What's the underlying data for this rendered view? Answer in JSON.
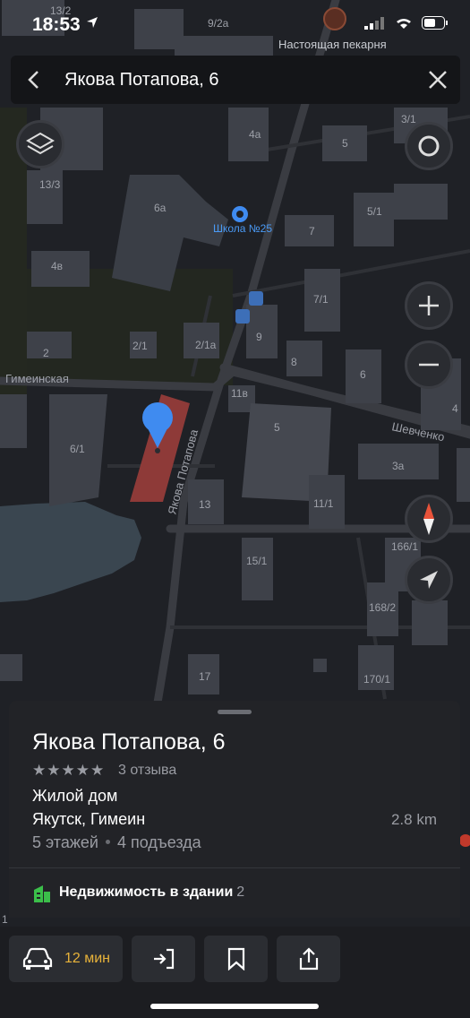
{
  "status_bar": {
    "time": "18:53"
  },
  "map": {
    "poi": {
      "bakery_name": "Настоящая пекарня",
      "school_name": "Школа №25"
    },
    "street_labels": [
      "Гимеинская",
      "Якова Потапова",
      "Шевченко"
    ],
    "building_labels": [
      "13/2",
      "9/2а",
      "13/3",
      "4а",
      "5",
      "3/1",
      "6а",
      "5/1",
      "7",
      "4в",
      "7/1",
      "2",
      "2/1",
      "2/1а",
      "9",
      "8",
      "6",
      "Гимеинская",
      "11в",
      "4",
      "6/1",
      "5",
      "3а",
      "13",
      "11/1",
      "15/1",
      "166/1",
      "168/2",
      "17",
      "170/1",
      "1"
    ]
  },
  "search": {
    "query": "Якова Потапова, 6"
  },
  "place": {
    "title": "Якова Потапова, 6",
    "rating_stars": "★★★★★",
    "reviews": "3 отзыва",
    "type": "Жилой дом",
    "address": "Якутск, Гимеин",
    "distance": "2.8 km",
    "floors": "5 этажей",
    "entrances": "4 подъезда",
    "realty_label": "Недвижимость в здании",
    "realty_count": "2"
  },
  "actions": {
    "eta": "12 мин"
  },
  "colors": {
    "accent_eta": "#e8b33a",
    "pin": "#3f8bf0",
    "selected_building": "#8e3a38",
    "realty_icon": "#3bbf4a"
  }
}
